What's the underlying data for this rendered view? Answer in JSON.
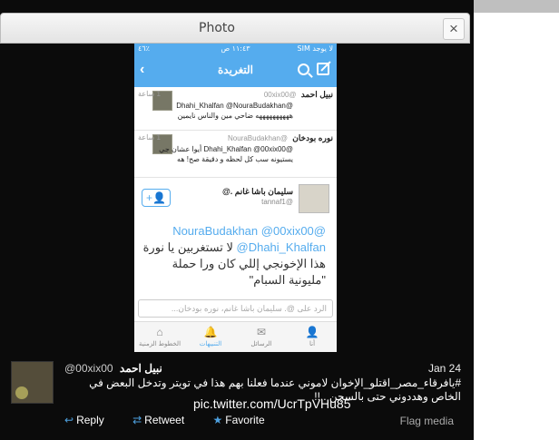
{
  "modal": {
    "title": "Photo",
    "close": "×"
  },
  "phone": {
    "status": {
      "carrier": "SIM ﻻ يوجد",
      "time": "١١:٤٣ ص",
      "battery": "٤٦٪"
    },
    "nav": {
      "title": "التغريدة",
      "back": "‹"
    },
    "tweets": [
      {
        "name": "نبيل احمد",
        "handle": "@00xix00",
        "time": "1 ساعة",
        "text": "@Dhahi_Khalfan @NouraBudakhan ههههههههههه ضاحي مين والناس نايمين"
      },
      {
        "name": "نوره بودخان",
        "handle": "@NouraBudakhan",
        "time": "1 ساعة",
        "text": "@Dhahi_Khalfan @00xix00 أيوا عشان جي يستيونه سب كل لحظه و دقيقة صح! هه"
      }
    ],
    "main_tweet": {
      "name": "سليمان باشا غانم .@",
      "handle": "@tannaf1",
      "mention1": "@00xix00",
      "mention2": "@NouraBudakhan",
      "mention3": "@Dhahi_Khalfan",
      "text": "لا تستغربين يا نورة هذا الإخونجي إللي كان ورا حملة \"مليونية السبام\""
    },
    "reply_placeholder": "الرد على @. سليمان باشا غانم، نوره بودخان...",
    "tabs": [
      {
        "label": "أنا",
        "icon": "person-icon"
      },
      {
        "label": "الرسائل",
        "icon": "envelope-icon"
      },
      {
        "label": "التنبيهات",
        "icon": "bell-icon"
      },
      {
        "label": "الخطوط الزمنية",
        "icon": "home-icon"
      }
    ]
  },
  "footer": {
    "name": "نبيل احمد",
    "handle": "@00xix00",
    "date": "Jan 24",
    "text": "#يافرقاء_مصر_اقتلو_الإخوان  لاموني عندما فعلنا بهم هذا في تويتر وتدخل البعض في الخاص وهددوني حتى بالسجن ..!!",
    "link": "pic.twitter.com/UcrTpVHu85",
    "actions": {
      "reply": "Reply",
      "retweet": "Retweet",
      "favorite": "Favorite"
    },
    "flag": "Flag media"
  }
}
